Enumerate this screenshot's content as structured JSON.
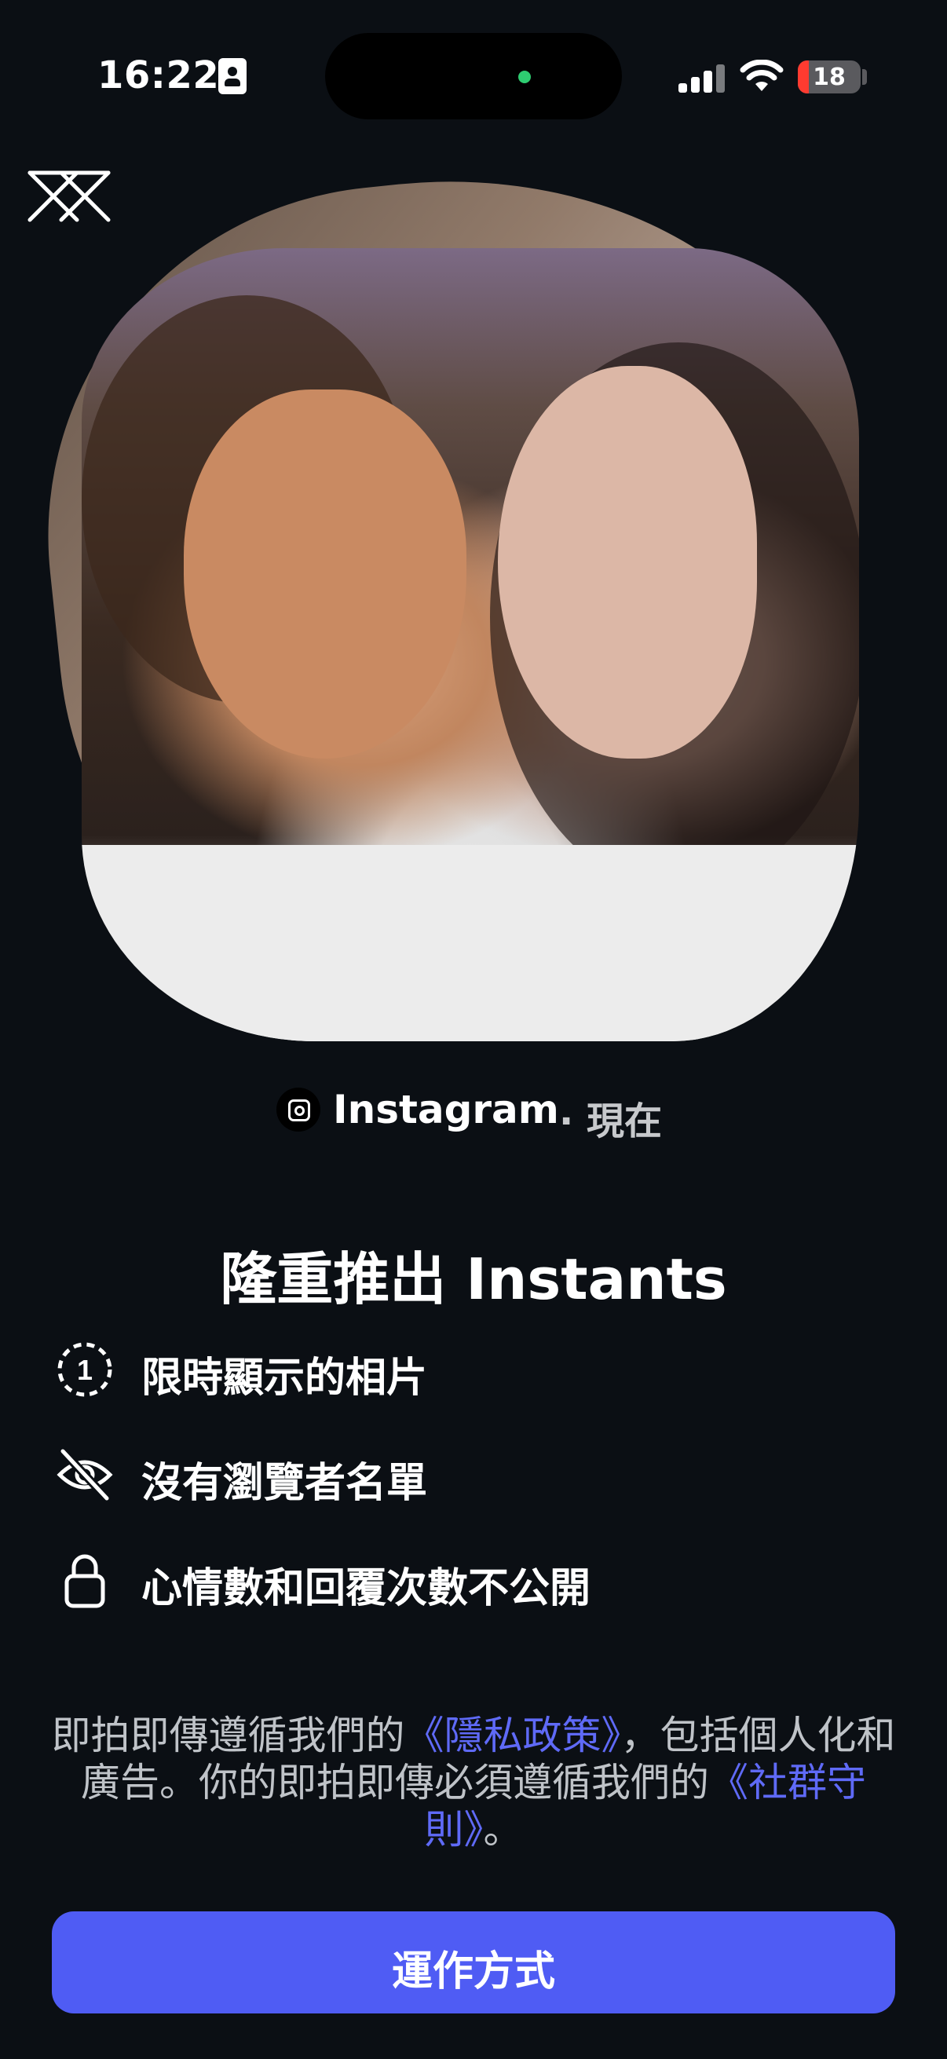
{
  "status_bar": {
    "time": "16:22",
    "battery_percent": "18",
    "battery_level": 0.18,
    "battery_color": "#ff3b30",
    "privacy_indicator_color": "#2ecc71"
  },
  "header": {
    "close_icon": "close-icon"
  },
  "photo": {
    "description_icon": "instant-photo"
  },
  "source": {
    "app_name": "Instagram",
    "separator": "·",
    "timestamp": "現在",
    "icon": "instagram-icon"
  },
  "main": {
    "title": "隆重推出 Instants",
    "features": [
      {
        "icon": "timer-one-icon",
        "label": "限時顯示的相片"
      },
      {
        "icon": "eye-off-icon",
        "label": "沒有瀏覽者名單"
      },
      {
        "icon": "lock-icon",
        "label": "心情數和回覆次數不公開"
      }
    ]
  },
  "policy": {
    "text_1": "即拍即傳遵循我們的",
    "link_privacy": "《隱私政策》",
    "text_2": "，包括個人化和廣告。你的即拍即傳必須遵循我們的",
    "link_guidelines": "《社群守則》",
    "text_3": "。"
  },
  "cta": {
    "label": "運作方式"
  },
  "colors": {
    "background": "#0b0f14",
    "accent": "#4f5cf4",
    "link": "#5f6af7"
  }
}
